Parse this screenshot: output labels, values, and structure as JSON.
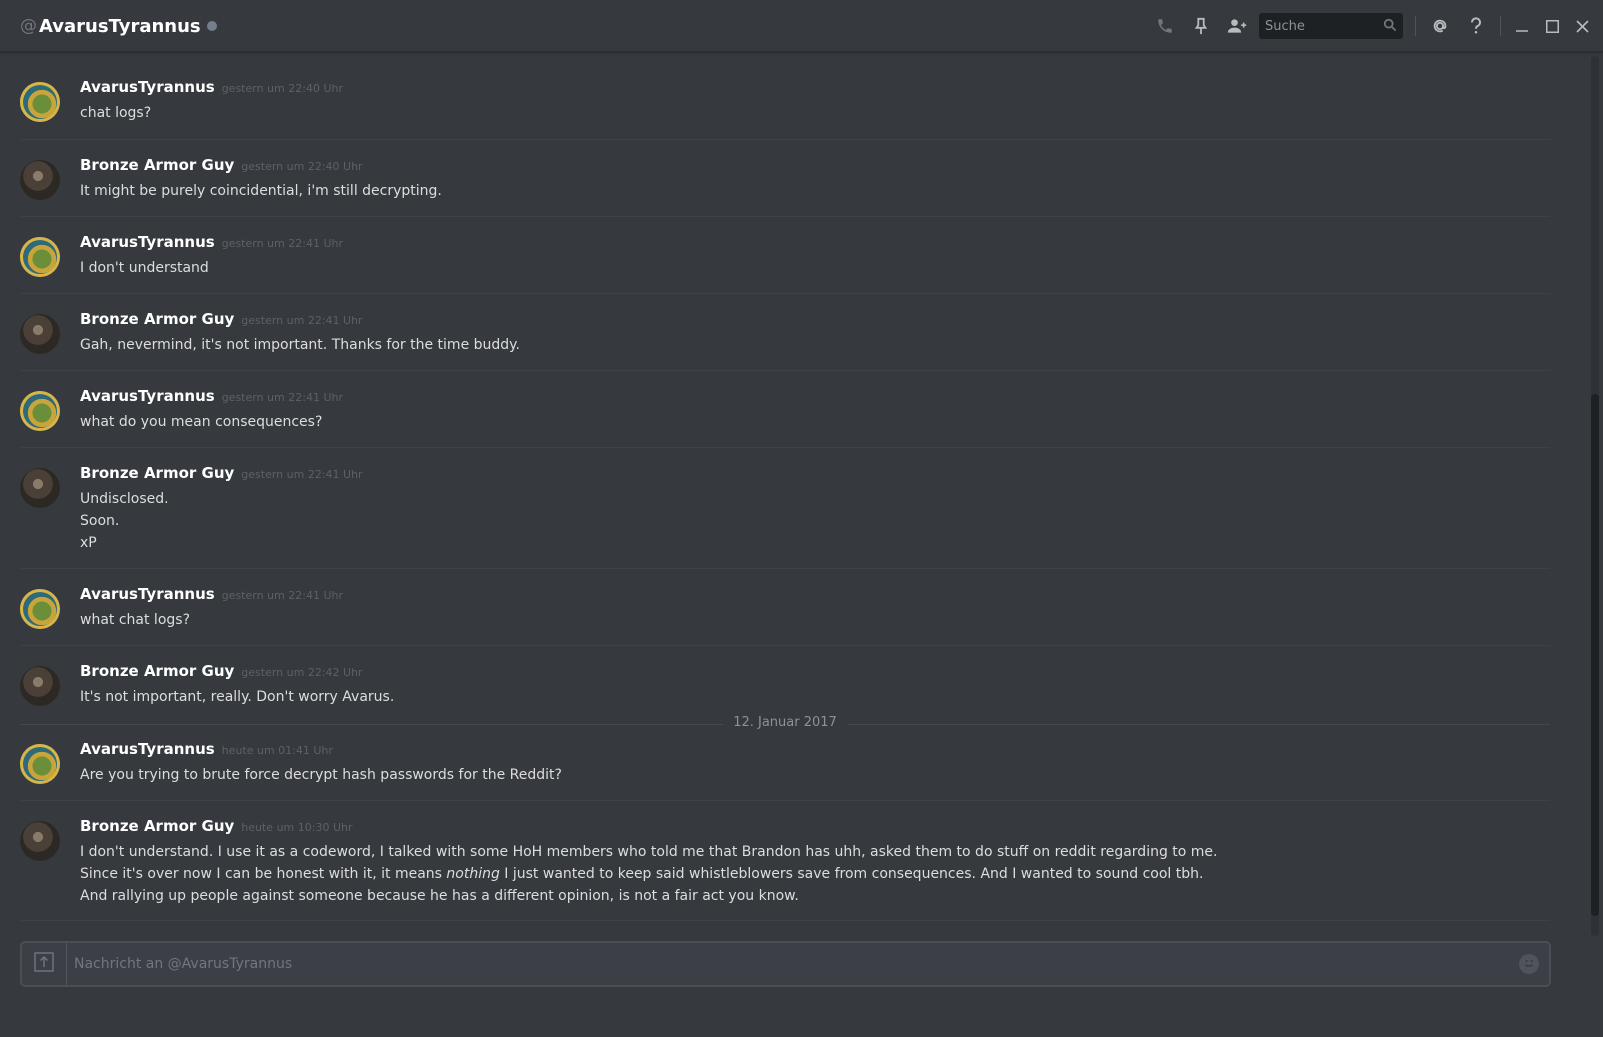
{
  "header": {
    "at": "@",
    "channel": "AvarusTyrannus",
    "search_placeholder": "Suche",
    "icons": [
      "phone-icon",
      "pin-icon",
      "add-friend-icon",
      "search-icon",
      "mention-icon",
      "help-icon",
      "minimize-icon",
      "maximize-icon",
      "close-icon"
    ]
  },
  "messages": [
    {
      "author": "AvarusTyrannus",
      "timestamp": "gestern um 22:40 Uhr",
      "lines": [
        "chat logs?"
      ]
    },
    {
      "author": "Bronze Armor Guy",
      "timestamp": "gestern um 22:40 Uhr",
      "lines": [
        "It might be purely coincidential, i'm still decrypting."
      ]
    },
    {
      "author": "AvarusTyrannus",
      "timestamp": "gestern um 22:41 Uhr",
      "lines": [
        "I don't understand"
      ]
    },
    {
      "author": "Bronze Armor Guy",
      "timestamp": "gestern um 22:41 Uhr",
      "lines": [
        "Gah, nevermind, it's not important. Thanks for the time buddy."
      ]
    },
    {
      "author": "AvarusTyrannus",
      "timestamp": "gestern um 22:41 Uhr",
      "lines": [
        "what do you mean consequences?"
      ]
    },
    {
      "author": "Bronze Armor Guy",
      "timestamp": "gestern um 22:41 Uhr",
      "lines": [
        "Undisclosed.",
        "Soon.",
        "xP"
      ]
    },
    {
      "author": "AvarusTyrannus",
      "timestamp": "gestern um 22:41 Uhr",
      "lines": [
        "what chat logs?"
      ]
    },
    {
      "author": "Bronze Armor Guy",
      "timestamp": "gestern um 22:42 Uhr",
      "lines": [
        "It's not important, really. Don't worry Avarus."
      ]
    },
    {
      "author": "AvarusTyrannus",
      "timestamp": "heute um 01:41 Uhr",
      "lines": [
        "Are you trying to brute force decrypt hash passwords for the Reddit?"
      ]
    },
    {
      "author": "Bronze Armor Guy",
      "timestamp": "heute um 10:30 Uhr",
      "lines": [
        "I don't understand. I use it as a codeword, I talked with some HoH members who told me that Brandon has uhh, asked them to do stuff on reddit regarding to me.",
        "Since it's over now I can be honest with it, it means ",
        "And rallying up people against someone because he has a different opinion, is not a fair act you know."
      ],
      "line2_italic": "nothing",
      "line2_tail": " I just wanted to keep said whistleblowers save from consequences. And I wanted to sound cool tbh."
    }
  ],
  "date_divider": "12. Januar 2017",
  "composer": {
    "placeholder": "Nachricht an @AvarusTyrannus"
  },
  "colors": {
    "background": "#36393e",
    "author": "#ffffff",
    "text": "#dcddde",
    "timestamp": "#5d6167"
  }
}
